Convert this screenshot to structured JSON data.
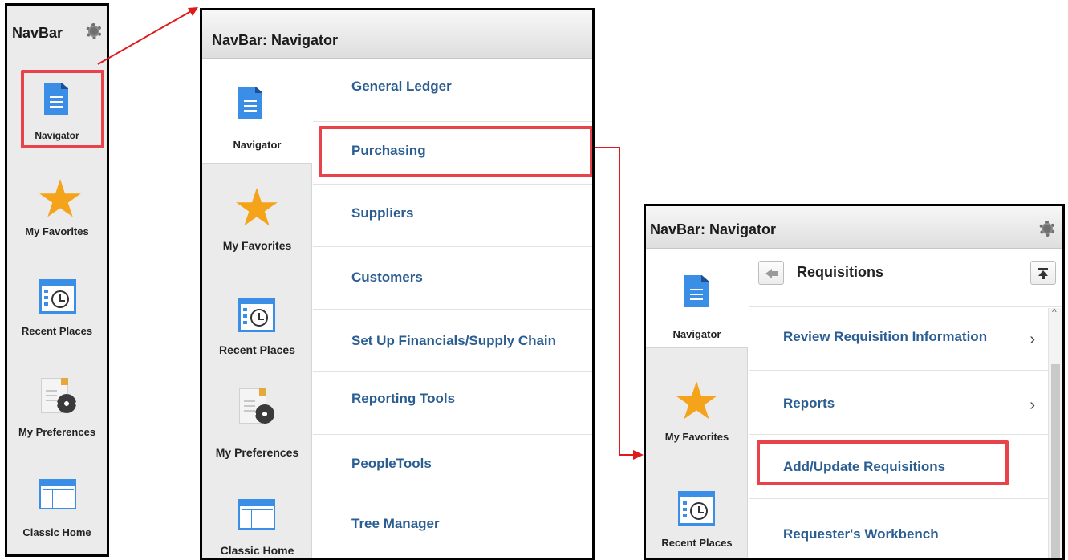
{
  "panel1": {
    "title": "NavBar",
    "tiles": [
      "Navigator",
      "My Favorites",
      "Recent Places",
      "My Preferences",
      "Classic Home"
    ]
  },
  "panel2": {
    "title": "NavBar: Navigator",
    "tiles": [
      "Navigator",
      "My Favorites",
      "Recent Places",
      "My Preferences",
      "Classic Home"
    ],
    "menu": [
      "General Ledger",
      "Purchasing",
      "Suppliers",
      "Customers",
      "Set Up Financials/Supply Chain",
      "Reporting Tools",
      "PeopleTools",
      "Tree Manager"
    ]
  },
  "panel3": {
    "title": "NavBar: Navigator",
    "tiles": [
      "Navigator",
      "My Favorites",
      "Recent Places"
    ],
    "breadcrumb": "Requisitions",
    "menu": [
      "Review Requisition Information",
      "Reports",
      "Add/Update Requisitions",
      "Requester's Workbench"
    ],
    "chevron": "›"
  },
  "colors": {
    "highlight": "#e8424b",
    "link": "#2a5d91",
    "icon_blue": "#3a8ee6",
    "star": "#f5a31a"
  }
}
